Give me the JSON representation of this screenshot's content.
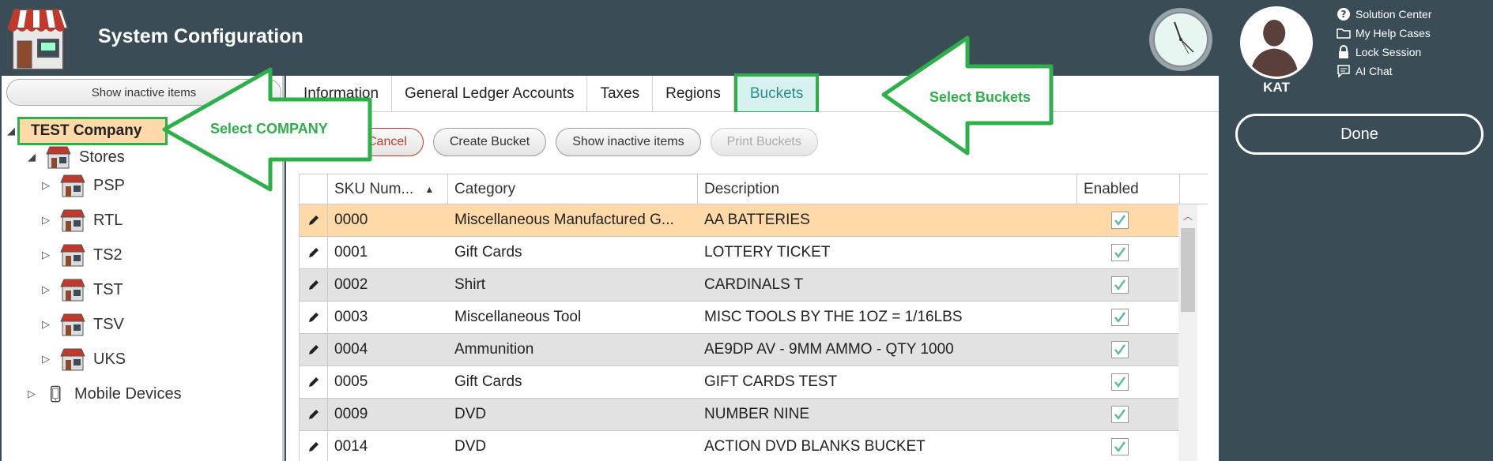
{
  "header": {
    "title": "System Configuration"
  },
  "left": {
    "show_inactive_label": "Show inactive items",
    "tree": {
      "company": "TEST Company",
      "stores_label": "Stores",
      "stores": [
        "PSP",
        "RTL",
        "TS2",
        "TST",
        "TSV",
        "UKS"
      ],
      "mobile_label": "Mobile Devices"
    }
  },
  "tabs": [
    "Information",
    "General Ledger Accounts",
    "Taxes",
    "Regions",
    "Buckets"
  ],
  "active_tab": "Buckets",
  "toolbar": {
    "cancel": "Cancel",
    "create": "Create Bucket",
    "show_inactive": "Show inactive items",
    "print": "Print Buckets"
  },
  "grid": {
    "columns": [
      "SKU Num...",
      "Category",
      "Description",
      "Enabled"
    ],
    "sort_indicator": "▲",
    "rows": [
      {
        "sku": "0000",
        "category": "Miscellaneous Manufactured G...",
        "description": "AA BATTERIES",
        "enabled": true
      },
      {
        "sku": "0001",
        "category": "Gift Cards",
        "description": "LOTTERY TICKET",
        "enabled": true
      },
      {
        "sku": "0002",
        "category": "Shirt",
        "description": "CARDINALS T",
        "enabled": true
      },
      {
        "sku": "0003",
        "category": "Miscellaneous Tool",
        "description": "MISC TOOLS BY THE 1OZ = 1/16LBS",
        "enabled": true
      },
      {
        "sku": "0004",
        "category": "Ammunition",
        "description": "AE9DP AV - 9MM AMMO - QTY 1000",
        "enabled": true
      },
      {
        "sku": "0005",
        "category": "Gift Cards",
        "description": "GIFT CARDS TEST",
        "enabled": true
      },
      {
        "sku": "0009",
        "category": "DVD",
        "description": "NUMBER NINE",
        "enabled": true
      },
      {
        "sku": "0014",
        "category": "DVD",
        "description": "ACTION DVD BLANKS BUCKET",
        "enabled": true
      }
    ]
  },
  "right": {
    "username": "KAT",
    "links": [
      "Solution Center",
      "My Help Cases",
      "Lock Session",
      "AI Chat"
    ],
    "done": "Done"
  },
  "annotations": {
    "select_company": "Select COMPANY",
    "select_buckets": "Select Buckets"
  },
  "colors": {
    "background": "#3a4d57",
    "selected_row": "#ffd9a8",
    "active_tab": "#d7f1ee",
    "annotation": "#2db04a",
    "cancel": "#c0392b"
  }
}
